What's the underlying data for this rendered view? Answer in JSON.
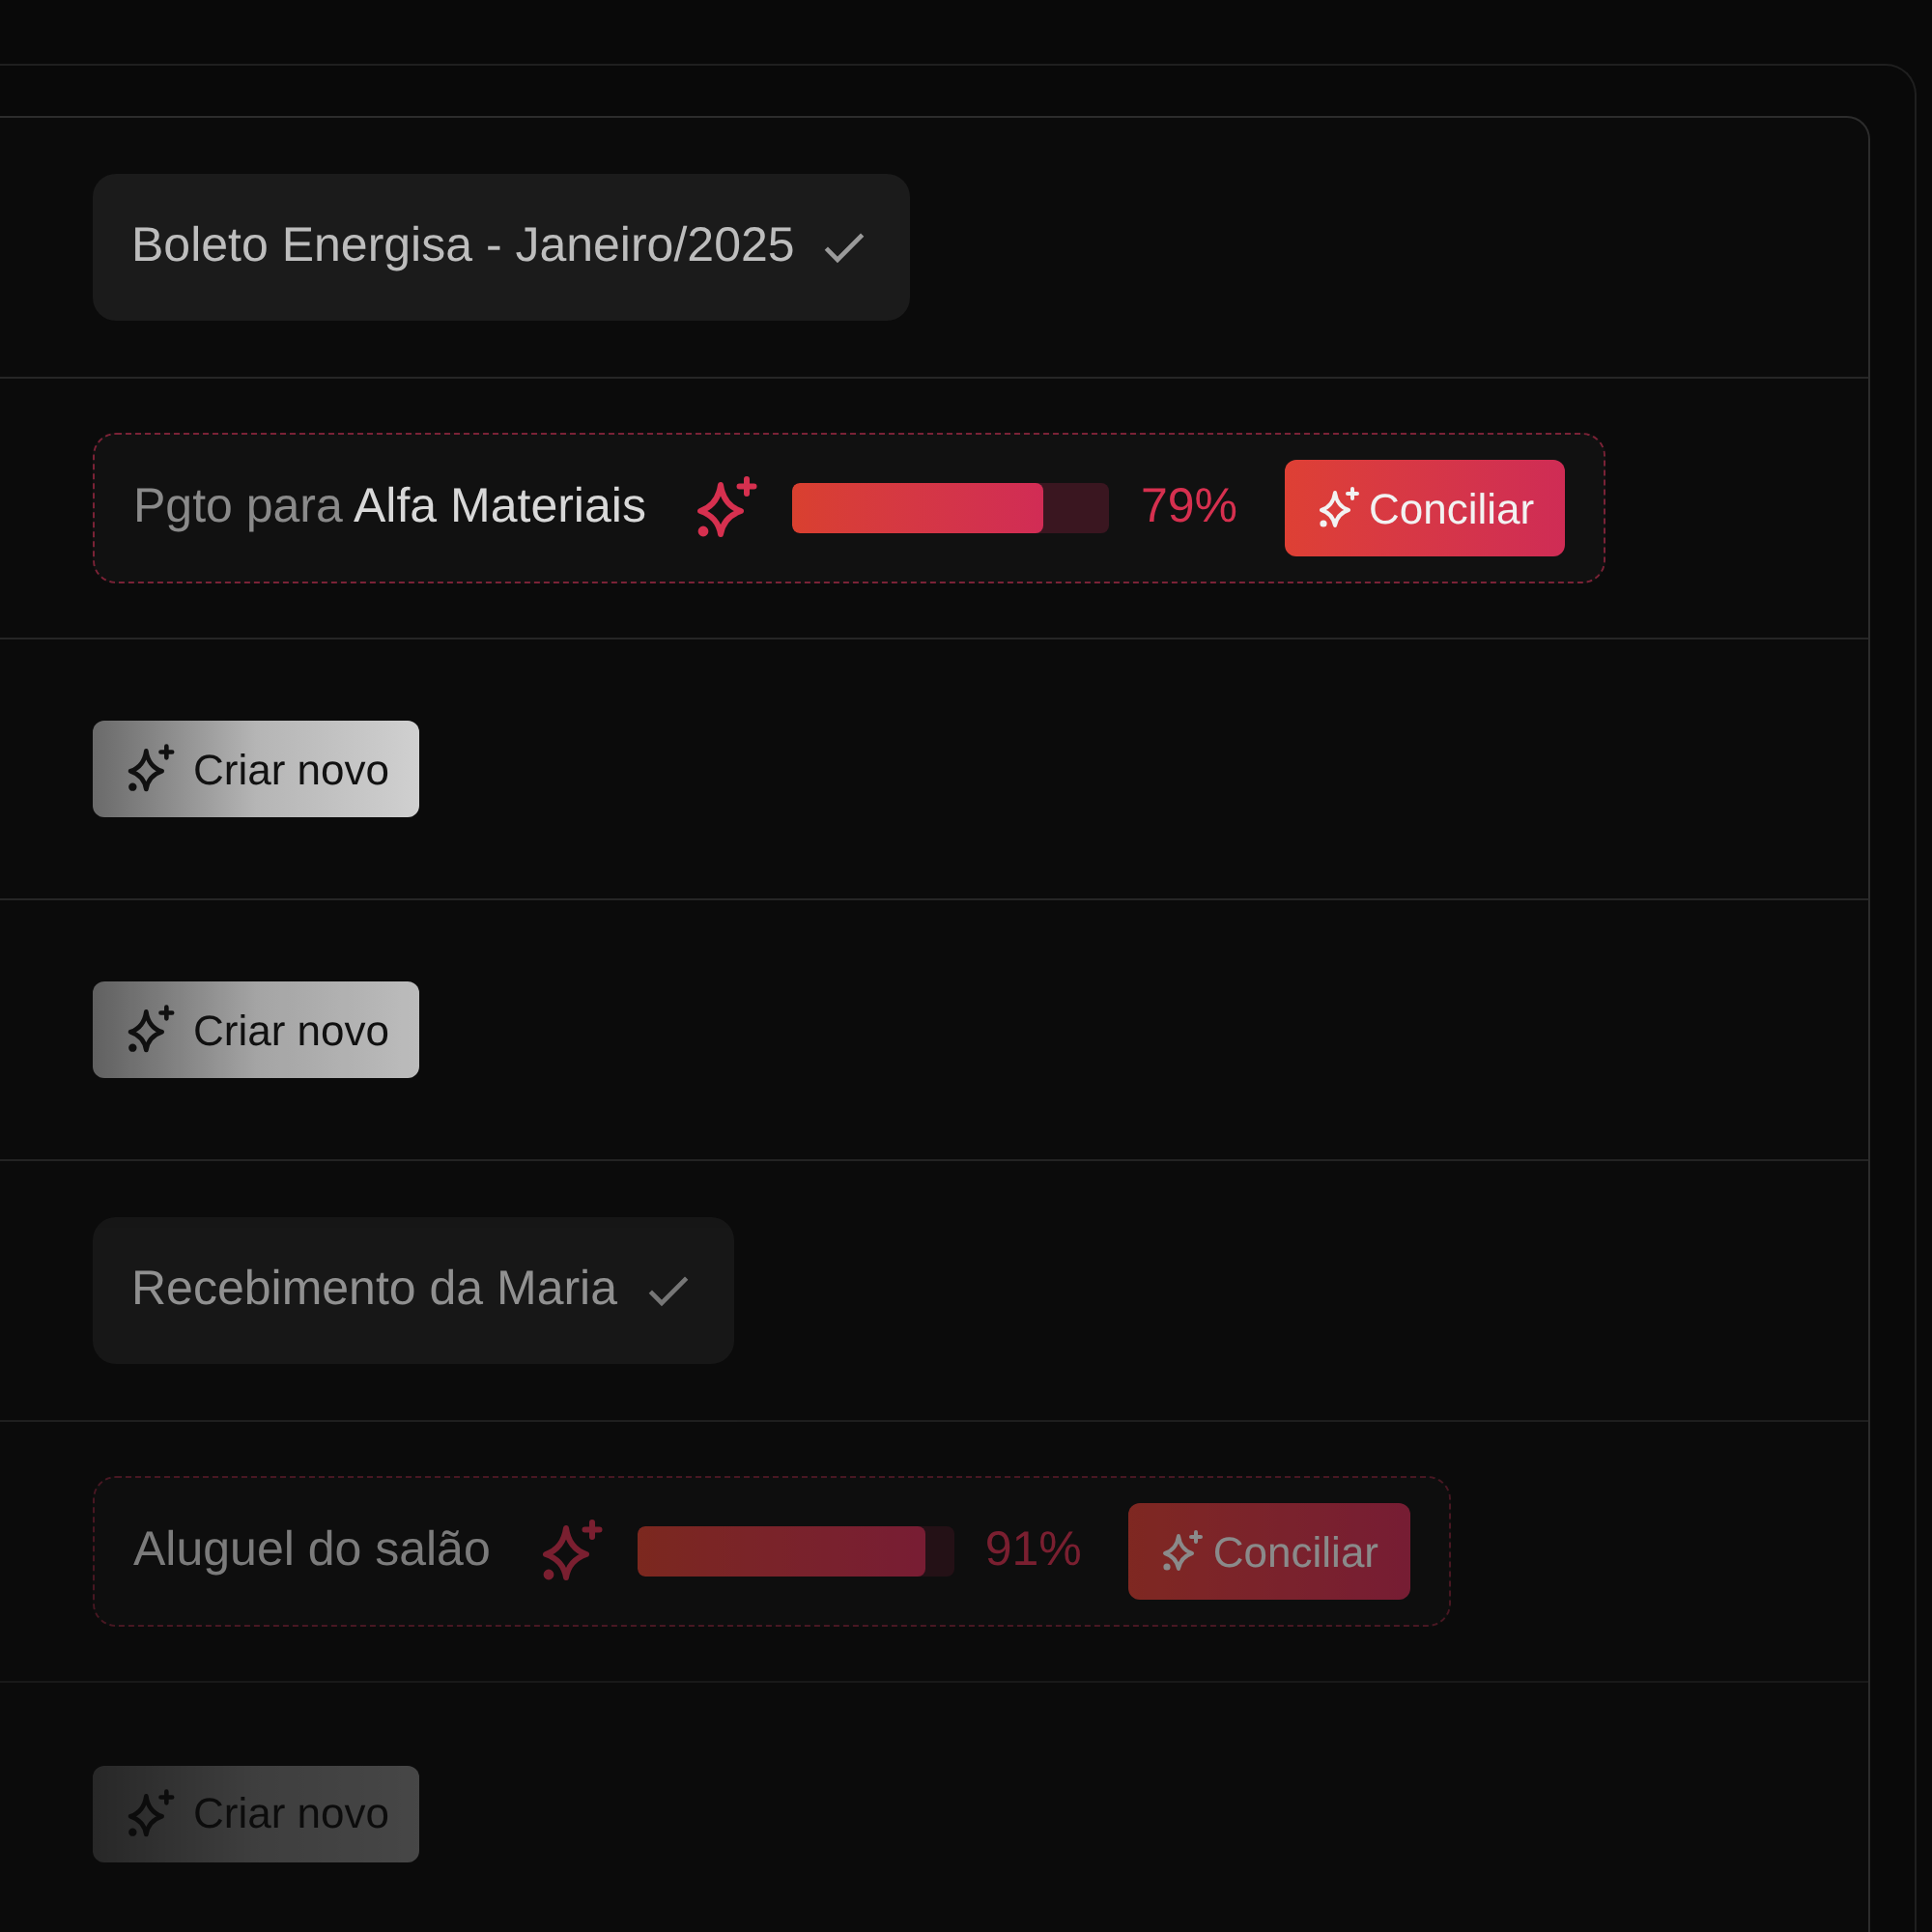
{
  "rows": [
    {
      "kind": "done",
      "label": "Boleto Energisa - Janeiro/2025"
    },
    {
      "kind": "match",
      "prefix": "Pgto para",
      "name": "Alfa Materiais",
      "level": 0.79,
      "percent": "79%",
      "action": "Conciliar"
    },
    {
      "kind": "create",
      "action": "Criar novo"
    },
    {
      "kind": "create",
      "action": "Criar novo"
    },
    {
      "kind": "done",
      "label": "Recebimento da Maria"
    },
    {
      "kind": "match",
      "name": "Aluguel do salão",
      "level": 0.91,
      "percent": "91%",
      "action": "Conciliar"
    },
    {
      "kind": "create",
      "action": "Criar novo"
    }
  ]
}
